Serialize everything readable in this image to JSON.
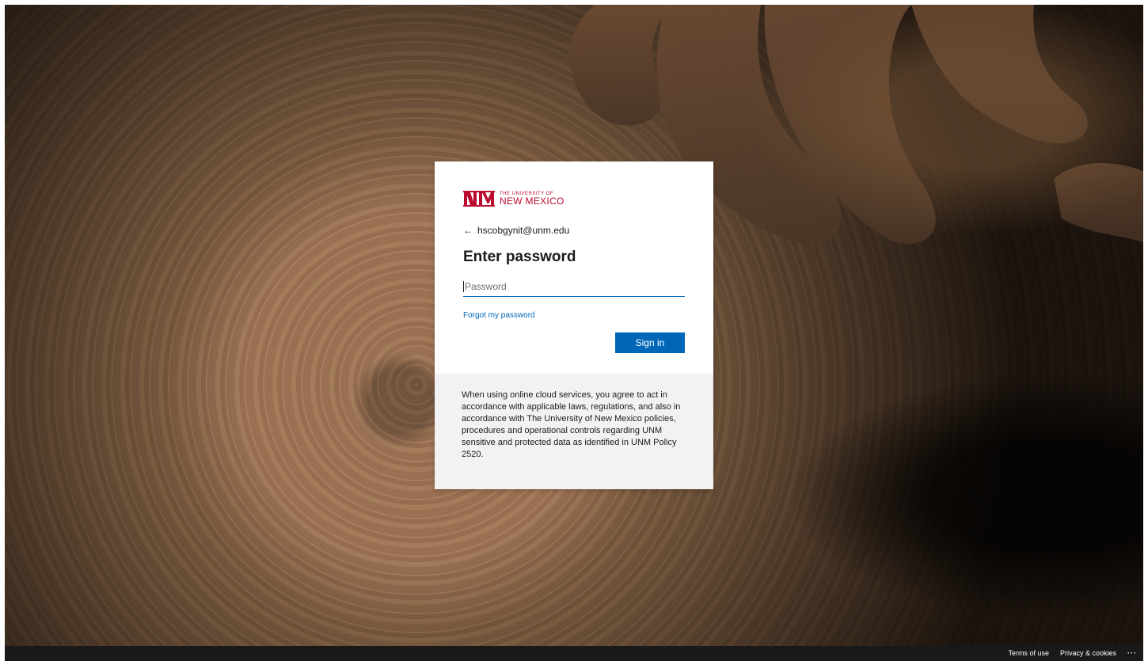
{
  "branding": {
    "university_small": "THE UNIVERSITY OF",
    "university_big": "NEW MEXICO",
    "brand_color": "#ba0c2f"
  },
  "signin": {
    "back_icon": "arrow-left-icon",
    "email": "hscobgynit@unm.edu",
    "title": "Enter password",
    "password_placeholder": "Password",
    "forgot_password": "Forgot my password",
    "sign_in": "Sign in",
    "accent_color": "#0067b8"
  },
  "notice": {
    "text": "When using online cloud services, you agree to act in accordance with applicable laws, regulations, and also in accordance with The University of New Mexico policies, procedures and operational controls regarding UNM sensitive and protected data as identified in UNM Policy 2520."
  },
  "footer": {
    "terms": "Terms of use",
    "privacy": "Privacy & cookies",
    "more": "···"
  }
}
